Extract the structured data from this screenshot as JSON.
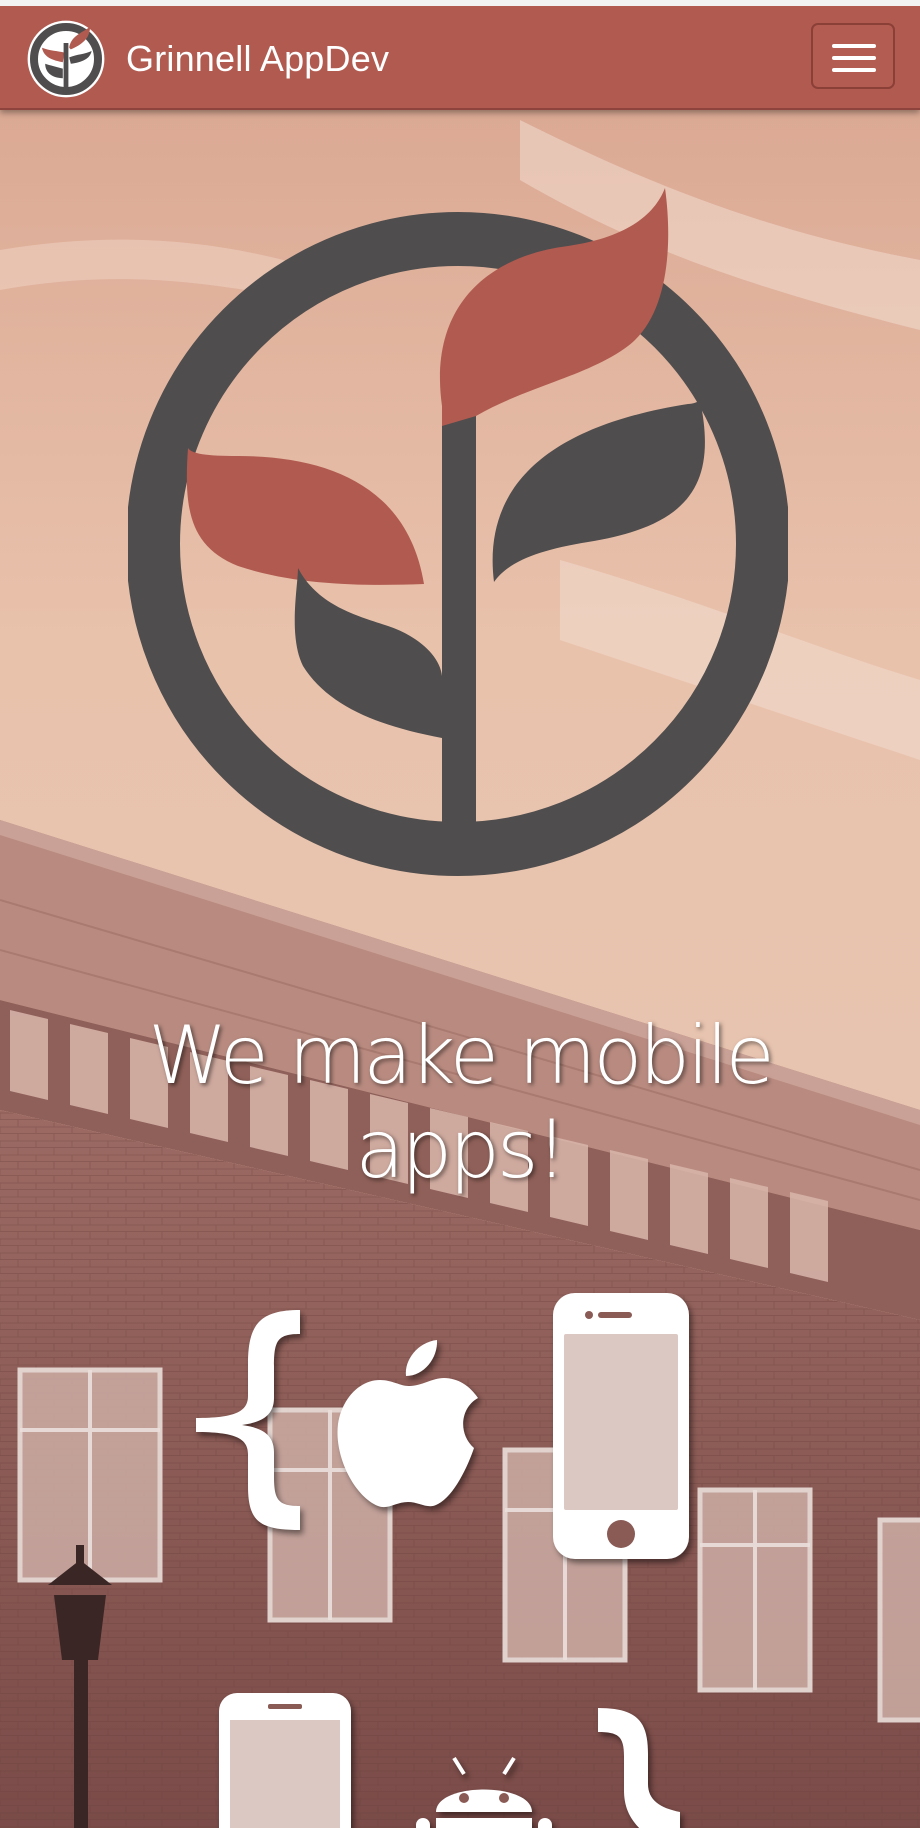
{
  "navbar": {
    "brand_name": "Grinnell AppDev",
    "logo_icon": "grinnell-appdev-logo-icon",
    "menu_icon": "hamburger-menu-icon"
  },
  "hero": {
    "tagline": "We make mobile apps!",
    "logo_icon": "grinnell-appdev-logo-icon",
    "feature_icons": [
      "curly-brace-open-icon",
      "apple-icon",
      "iphone-icon",
      "android-phone-icon",
      "android-icon",
      "curly-brace-close-icon"
    ]
  },
  "colors": {
    "accent": "#b15a50",
    "logo_gray": "#4f4d4d",
    "leaf_red": "#b15a50",
    "text_white": "#ffffff"
  }
}
